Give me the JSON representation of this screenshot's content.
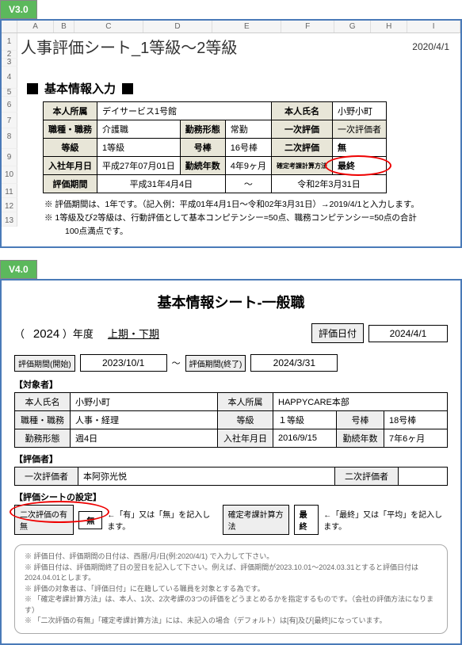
{
  "v3": {
    "version": "V3.0",
    "cols": [
      "A",
      "B",
      "C",
      "D",
      "E",
      "F",
      "G",
      "H",
      "I"
    ],
    "rows": [
      "1",
      "2",
      "3",
      "4",
      "5",
      "6",
      "7",
      "8",
      "9",
      "10",
      "11",
      "12",
      "13"
    ],
    "title": "人事評価シート_1等級～2等級",
    "top_date": "2020/4/1",
    "section": "基本情報入力",
    "labels": {
      "affiliation": "本人所属",
      "name": "本人氏名",
      "jobtype": "職種・職務",
      "worktype": "勤務形態",
      "primary": "一次評価",
      "primary_evaluator": "一次評価者",
      "grade": "等級",
      "pay": "号棒",
      "secondary": "二次評価",
      "mu": "無",
      "hire": "入社年月日",
      "years": "勤続年数",
      "method": "確定考課計算方法",
      "saishu": "最終",
      "period": "評価期間",
      "tilde": "～"
    },
    "values": {
      "affiliation": "デイサービス1号館",
      "name": "小野小町",
      "jobtype": "介護職",
      "worktype": "常勤",
      "grade": "1等級",
      "pay": "16号棒",
      "hire": "平成27年07月01日",
      "years": "4年9ヶ月",
      "period_from": "平成31年4月4日",
      "period_to": "令和2年3月31日"
    },
    "notes": [
      "※ 評価期間は、1年です。（記入例：平成01年4月1日～令和02年3月31日）→2019/4/1と入力します。",
      "※ 1等級及び2等級は、行動評価として基本コンピテンシー=50点、職務コンピテンシー=50点の合計",
      "100点満点です。"
    ]
  },
  "v4": {
    "version": "V4.0",
    "title": "基本情報シート-一般職",
    "year_open": "（",
    "year": "2024",
    "year_label": "）年度",
    "term": "上期・下期",
    "eval_date_label": "評価日付",
    "eval_date": "2024/4/1",
    "period_start_label": "評価期間(開始)",
    "period_start": "2023/10/1",
    "tilde": "～",
    "period_end_label": "評価期間(終了)",
    "period_end": "2024/3/31",
    "group_target": "【対象者】",
    "labels": {
      "name": "本人氏名",
      "affiliation": "本人所属",
      "jobtype": "職種・職務",
      "grade": "等級",
      "pay": "号棒",
      "worktype": "勤務形態",
      "hire": "入社年月日",
      "years": "勤続年数"
    },
    "values": {
      "name": "小野小町",
      "affiliation": "HAPPYCARE本部",
      "jobtype": "人事・経理",
      "grade": "１等級",
      "pay": "18号棒",
      "worktype": "週4日",
      "hire": "2016/9/15",
      "years": "7年6ヶ月"
    },
    "group_eval": "【評価者】",
    "primary_label": "一次評価者",
    "primary": "本阿弥光悦",
    "secondary_label": "二次評価者",
    "secondary": "",
    "group_settings": "【評価シートの設定】",
    "set_sec_label": "二次評価の有無",
    "set_sec_val": "無",
    "set_sec_hint": "←「有」又は「無」を記入します。",
    "set_method_label": "確定考課計算方法",
    "set_method_val": "最終",
    "set_method_hint": "←「最終」又は「平均」を記入します。",
    "fineprint": [
      "※ 評価日付、評価期間の日付は、西暦/月/日(例:2020/4/1) で入力して下さい。",
      "※ 評価日付は、評価期間終了日の翌日を記入して下さい。例えば、評価期間が2023.10.01～2024.03.31とすると評価日付は2024.04.01とします。",
      "※ 評価の対象者は、「評価日付」に在籍している職員を対象とする為です。",
      "※ 「確定考課計算方法」は、本人、1次、2次考課の3つの評価をどうまとめるかを指定するものです。（会社の評価方法になります）",
      "※ 「二次評価の有無」「確定考課計算方法」には、未記入の場合（デフォルト）は[有]及び[最終]になっています。"
    ]
  }
}
